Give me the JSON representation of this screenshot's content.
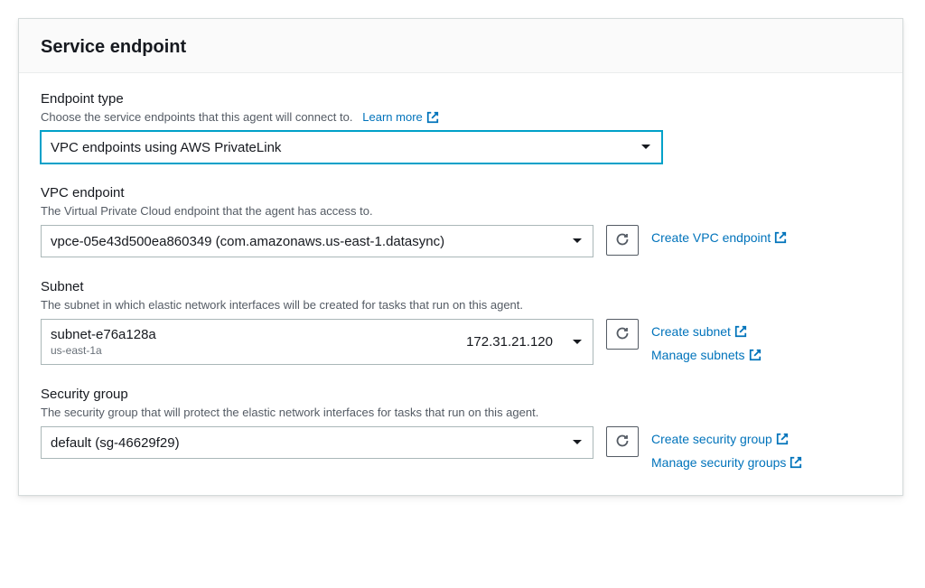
{
  "panel": {
    "title": "Service endpoint"
  },
  "endpointType": {
    "label": "Endpoint type",
    "description": "Choose the service endpoints that this agent will connect to.",
    "learnMore": "Learn more",
    "selected": "VPC endpoints using AWS PrivateLink"
  },
  "vpcEndpoint": {
    "label": "VPC endpoint",
    "description": "The Virtual Private Cloud endpoint that the agent has access to.",
    "selected": "vpce-05e43d500ea860349 (com.amazonaws.us-east-1.datasync)",
    "createLink": "Create VPC endpoint"
  },
  "subnet": {
    "label": "Subnet",
    "description": "The subnet in which elastic network interfaces will be created for tasks that run on this agent.",
    "selectedId": "subnet-e76a128a",
    "selectedZone": "us-east-1a",
    "selectedIp": "172.31.21.120",
    "createLink": "Create subnet",
    "manageLink": "Manage subnets"
  },
  "securityGroup": {
    "label": "Security group",
    "description": "The security group that will protect the elastic network interfaces for tasks that run on this agent.",
    "selected": "default (sg-46629f29)",
    "createLink": "Create security group",
    "manageLink": "Manage security groups"
  }
}
